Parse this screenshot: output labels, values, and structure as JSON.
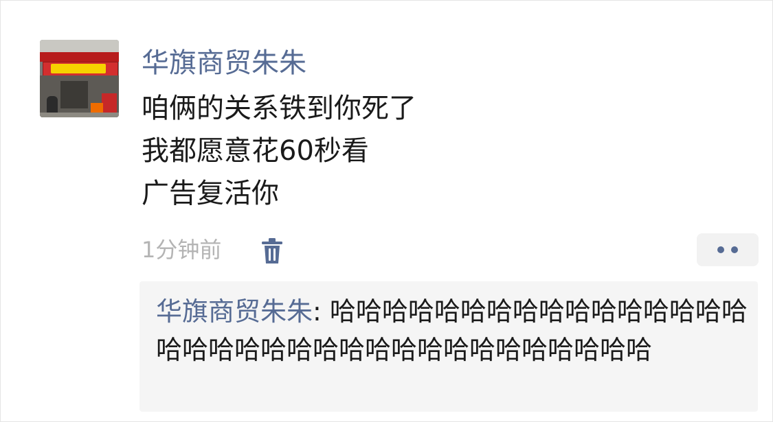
{
  "post": {
    "author": "华旗商贸朱朱",
    "content_lines": [
      "咱俩的关系铁到你死了",
      "我都愿意花60秒看",
      "广告复活你"
    ],
    "timestamp": "1分钟前",
    "delete_icon": "trash-icon",
    "more_icon": "more-dots-icon"
  },
  "avatar": {
    "description_icon": "shop-storefront-avatar"
  },
  "comments": [
    {
      "commenter": "华旗商贸朱朱",
      "separator": ": ",
      "text": "哈哈哈哈哈哈哈哈哈哈哈哈哈哈哈哈哈哈哈哈哈哈哈哈哈哈哈哈哈哈哈哈哈哈哈"
    }
  ],
  "colors": {
    "name_link": "#566b94",
    "timestamp": "#b4b4b4",
    "comment_bg": "#f5f5f5",
    "text": "#1a1a1a"
  }
}
